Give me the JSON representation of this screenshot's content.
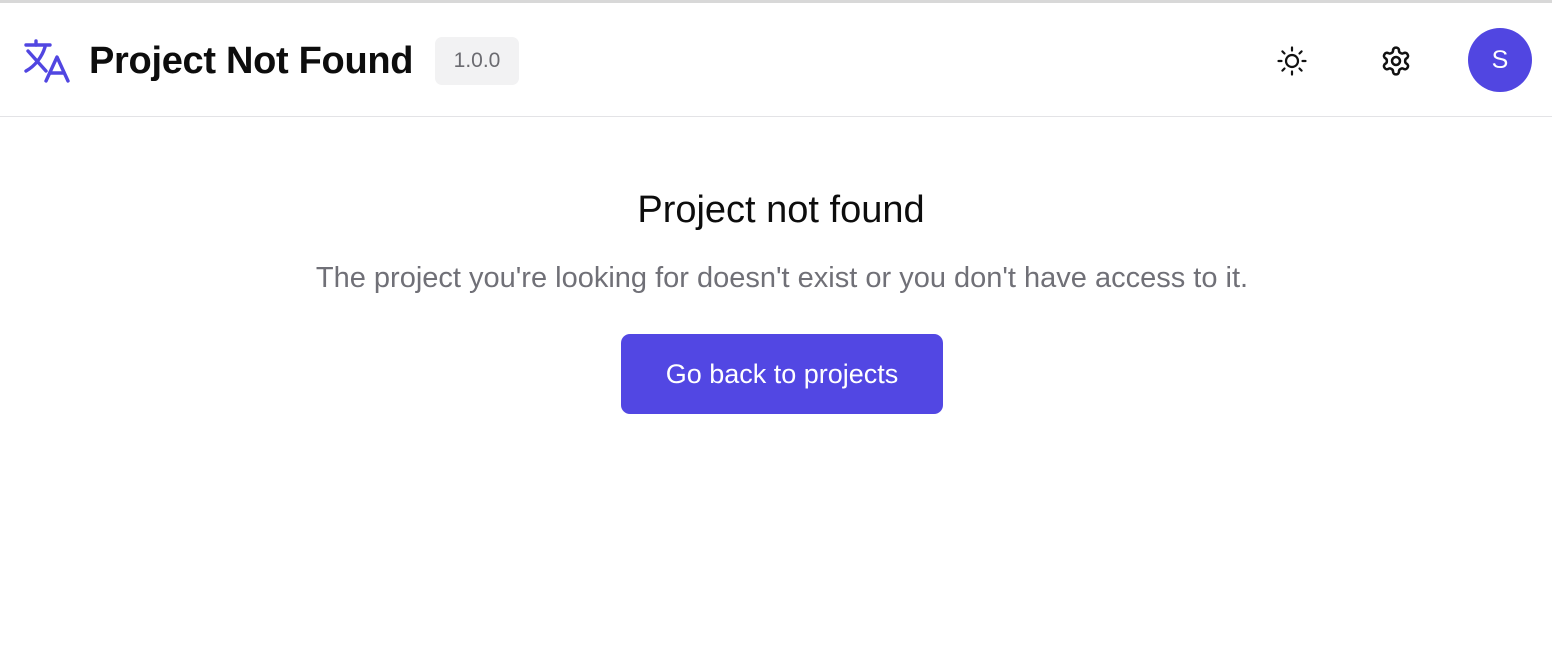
{
  "header": {
    "title": "Project Not Found",
    "version": "1.0.0",
    "logo_icon": "translate-icon",
    "theme_toggle_icon": "sun-icon",
    "settings_icon": "gear-icon",
    "avatar_initial": "S"
  },
  "main": {
    "heading": "Project not found",
    "message": "The project you're looking for doesn't exist or you don't have access to it.",
    "back_button_label": "Go back to projects"
  },
  "colors": {
    "accent": "#5146e1",
    "muted_text": "#707077",
    "badge_bg": "#f2f2f3"
  }
}
